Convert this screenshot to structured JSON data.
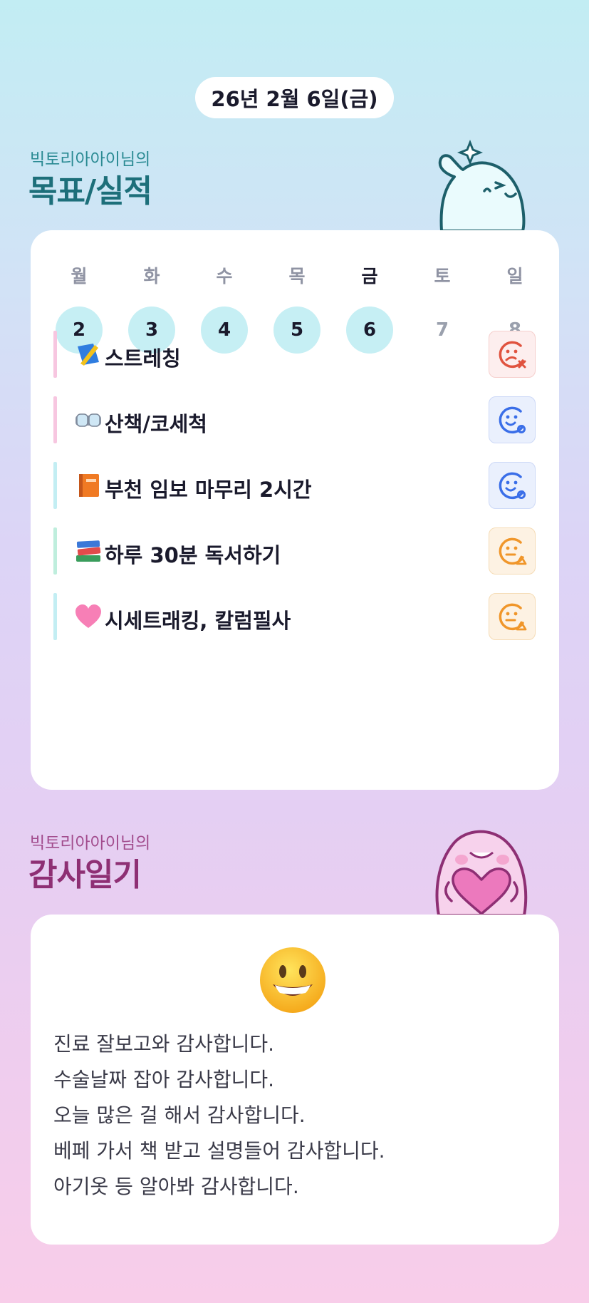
{
  "date": "26년 2월 6일(금)",
  "goals_section": {
    "owner": "빅토리아아이님의",
    "title": "목표/실적"
  },
  "week": [
    {
      "day": "월",
      "num": "2",
      "done": true,
      "today": false
    },
    {
      "day": "화",
      "num": "3",
      "done": true,
      "today": false
    },
    {
      "day": "수",
      "num": "4",
      "done": true,
      "today": false
    },
    {
      "day": "목",
      "num": "5",
      "done": true,
      "today": false
    },
    {
      "day": "금",
      "num": "6",
      "done": true,
      "today": true
    },
    {
      "day": "토",
      "num": "7",
      "done": false,
      "today": false
    },
    {
      "day": "일",
      "num": "8",
      "done": false,
      "today": false
    }
  ],
  "goals": [
    {
      "emoji": "sports-sash-icon",
      "text": "스트레칭",
      "bar_color": "#f7c6e0",
      "status": "fail"
    },
    {
      "emoji": "goggles-icon",
      "text": "산책/코세척",
      "bar_color": "#f7c6e0",
      "status": "done"
    },
    {
      "emoji": "orange-book-icon",
      "text": "부천 임보 마무리 2시간",
      "bar_color": "#c3eef3",
      "status": "done"
    },
    {
      "emoji": "books-icon",
      "text": "하루 30분 독서하기",
      "bar_color": "#bfeedd",
      "status": "partial"
    },
    {
      "emoji": "pink-heart-icon",
      "text": "시세트래킹, 칼럼필사",
      "bar_color": "#c3eef3",
      "status": "partial"
    }
  ],
  "status_colors": {
    "fail": "#e0533f",
    "done": "#3a6ee8",
    "partial": "#f0962a"
  },
  "gratitude_section": {
    "owner": "빅토리아아이님의",
    "title": "감사일기"
  },
  "gratitude_mood_icon": "grinning-face-icon",
  "gratitude_lines": [
    "진료 잘보고와 감사합니다.",
    "수술날짜 잡아 감사합니다.",
    "오늘 많은 걸 해서 감사합니다.",
    "베페 가서 책 받고 설명들어 감사합니다.",
    "아기옷 등 알아봐 감사합니다."
  ]
}
